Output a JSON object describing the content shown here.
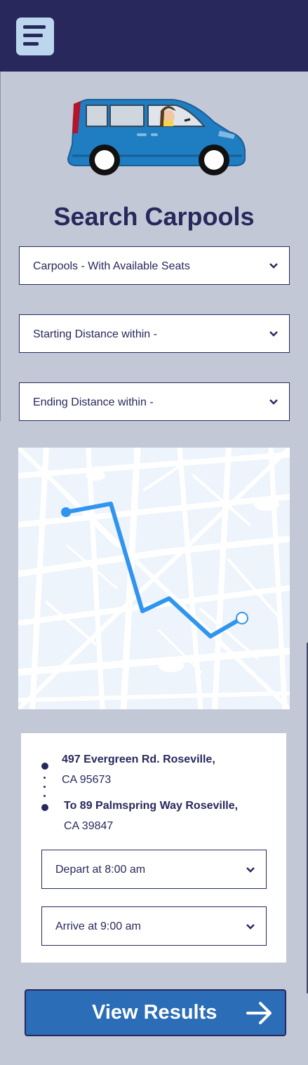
{
  "header": {
    "menu_icon": "hamburger-menu-icon"
  },
  "hero": {
    "image": "car-with-driver-illustration"
  },
  "page": {
    "title": "Search Carpools"
  },
  "filters": {
    "seats": "Carpools - With Available Seats",
    "start_distance": "Starting Distance within -",
    "end_distance": "Ending Distance within -"
  },
  "map": {
    "description_icon": "route-map"
  },
  "route": {
    "origin_line1": "497 Evergreen Rd. Roseville,",
    "origin_line2": "CA 95673",
    "destination_line1": "To 89 Palmspring Way Roseville,",
    "destination_line2": "CA 39847",
    "depart": "Depart at 8:00 am",
    "arrive": "Arrive at 9:00 am"
  },
  "cta": {
    "label": "View Results",
    "icon": "arrow-right-icon"
  },
  "colors": {
    "navy": "#28285c",
    "background": "#c3c8d6",
    "button_blue": "#2b6db6",
    "route_blue": "#2f95ee",
    "car_blue": "#1f7dc2"
  }
}
